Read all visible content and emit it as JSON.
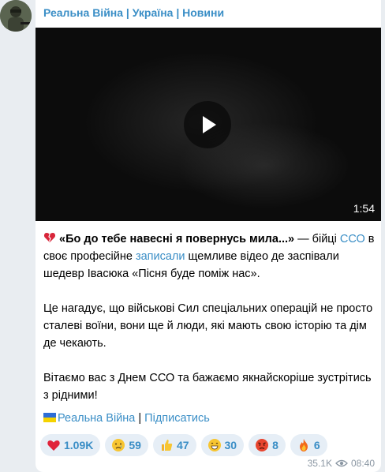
{
  "channel": {
    "name": "Реальна Війна | Україна | Новини"
  },
  "video": {
    "duration": "1:54"
  },
  "post": {
    "p1": {
      "quote": "«Бо до тебе навесні я повернусь мила...»",
      "t1": " — бійці ",
      "link_sso": "ССО",
      "t2": " в своє професійне ",
      "link_recorded": "записали",
      "t3": " щемливе відео де заспівали шедевр Івасюка «Пісня буде поміж нас»."
    },
    "p2": "Це нагадує, що військові Сил спеціальних операцій не просто сталеві воїни, вони ще й люди, які мають свою історію та дім де чекають.",
    "p3": "Вітаємо вас з Днем ССО та бажаємо якнайскоріше зустрітись з рідними!"
  },
  "footer": {
    "channel_link": "Реальна Війна",
    "separator": " | ",
    "subscribe_link": "Підписатись"
  },
  "reactions": [
    {
      "emoji": "heart-icon",
      "count": "1.09K"
    },
    {
      "emoji": "crying-face-icon",
      "count": "59"
    },
    {
      "emoji": "thumbs-up-icon",
      "count": "47"
    },
    {
      "emoji": "grinning-face-icon",
      "count": "30"
    },
    {
      "emoji": "angry-face-icon",
      "count": "8"
    },
    {
      "emoji": "fire-icon",
      "count": "6"
    }
  ],
  "meta": {
    "views": "35.1K",
    "time": "08:40"
  },
  "colors": {
    "accent": "#3a8ec6",
    "reaction_bg": "#e6eef6"
  }
}
